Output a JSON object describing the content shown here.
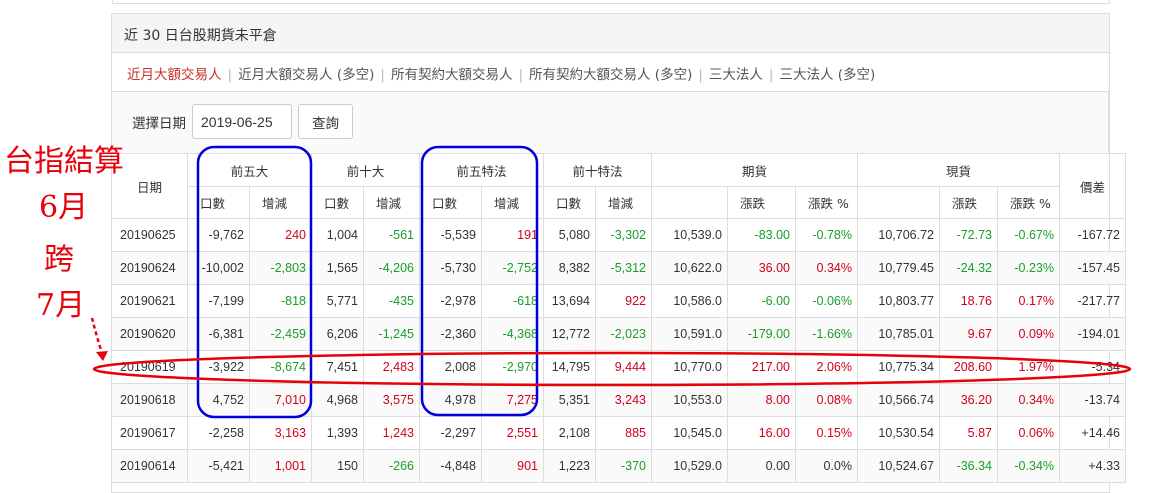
{
  "panel": {
    "title": "近 30 日台股期貨未平倉"
  },
  "tabs": [
    {
      "label": "近月大額交易人",
      "active": true
    },
    {
      "label": "近月大額交易人 (多空)",
      "active": false
    },
    {
      "label": "所有契約大額交易人",
      "active": false
    },
    {
      "label": "所有契約大額交易人 (多空)",
      "active": false
    },
    {
      "label": "三大法人",
      "active": false
    },
    {
      "label": "三大法人 (多空)",
      "active": false
    }
  ],
  "query": {
    "label": "選擇日期",
    "date_value": "2019-06-25",
    "button_label": "查詢"
  },
  "table": {
    "group_headers": [
      "日期",
      "前五大",
      "前十大",
      "前五特法",
      "前十特法",
      "期貨",
      "現貨",
      "價差"
    ],
    "sub_headers": [
      "口數",
      "增減",
      "口數",
      "增減",
      "口數",
      "增減",
      "口數",
      "增減",
      "",
      "漲跌",
      "漲跌 %",
      "",
      "漲跌",
      "漲跌 %"
    ],
    "rows": [
      [
        "20190625",
        "-9,762",
        "240",
        "1,004",
        "-561",
        "-5,539",
        "191",
        "5,080",
        "-3,302",
        "10,539.0",
        "-83.00",
        "-0.78%",
        "10,706.72",
        "-72.73",
        "-0.67%",
        "-167.72"
      ],
      [
        "20190624",
        "-10,002",
        "-2,803",
        "1,565",
        "-4,206",
        "-5,730",
        "-2,752",
        "8,382",
        "-5,312",
        "10,622.0",
        "36.00",
        "0.34%",
        "10,779.45",
        "-24.32",
        "-0.23%",
        "-157.45"
      ],
      [
        "20190621",
        "-7,199",
        "-818",
        "5,771",
        "-435",
        "-2,978",
        "-618",
        "13,694",
        "922",
        "10,586.0",
        "-6.00",
        "-0.06%",
        "10,803.77",
        "18.76",
        "0.17%",
        "-217.77"
      ],
      [
        "20190620",
        "-6,381",
        "-2,459",
        "6,206",
        "-1,245",
        "-2,360",
        "-4,368",
        "12,772",
        "-2,023",
        "10,591.0",
        "-179.00",
        "-1.66%",
        "10,785.01",
        "9.67",
        "0.09%",
        "-194.01"
      ],
      [
        "20190619",
        "-3,922",
        "-8,674",
        "7,451",
        "2,483",
        "2,008",
        "-2,970",
        "14,795",
        "9,444",
        "10,770.0",
        "217.00",
        "2.06%",
        "10,775.34",
        "208.60",
        "1.97%",
        "-5.34"
      ],
      [
        "20190618",
        "4,752",
        "7,010",
        "4,968",
        "3,575",
        "4,978",
        "7,275",
        "5,351",
        "3,243",
        "10,553.0",
        "8.00",
        "0.08%",
        "10,566.74",
        "36.20",
        "0.34%",
        "-13.74"
      ],
      [
        "20190617",
        "-2,258",
        "3,163",
        "1,393",
        "1,243",
        "-2,297",
        "2,551",
        "2,108",
        "885",
        "10,545.0",
        "16.00",
        "0.15%",
        "10,530.54",
        "5.87",
        "0.06%",
        "+14.46"
      ],
      [
        "20190614",
        "-5,421",
        "1,001",
        "150",
        "-266",
        "-4,848",
        "901",
        "1,223",
        "-370",
        "10,529.0",
        "0.00",
        "0.0%",
        "10,524.67",
        "-36.34",
        "-0.34%",
        "+4.33"
      ]
    ],
    "colored_columns": [
      2,
      4,
      6,
      8,
      10,
      11,
      13,
      14
    ]
  },
  "annotation": {
    "lines": [
      "台指結算",
      "6月",
      "跨",
      "7月"
    ],
    "color": "#e8000b",
    "box_color": "#0000dd"
  },
  "colors": {
    "up": "#d0021b",
    "down": "#1a9e2a",
    "active_tab": "#c9302c"
  }
}
